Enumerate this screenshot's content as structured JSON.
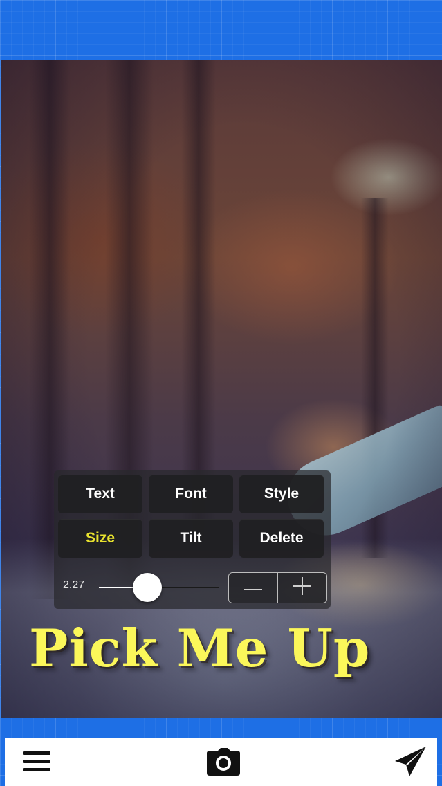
{
  "editor": {
    "caption_text": "Pick Me Up",
    "caption_color": "#fbf75a",
    "background_color": "#1e6fe5"
  },
  "panel": {
    "buttons": [
      {
        "label": "Text",
        "active": false
      },
      {
        "label": "Font",
        "active": false
      },
      {
        "label": "Style",
        "active": false
      },
      {
        "label": "Size",
        "active": true
      },
      {
        "label": "Tilt",
        "active": false
      },
      {
        "label": "Delete",
        "active": false
      }
    ],
    "active_color": "#e8e22e",
    "size_value": "2.27",
    "slider_fraction": 0.41,
    "stepper": {
      "decrement_icon": "minus-icon",
      "increment_icon": "plus-icon"
    }
  },
  "toolbar": {
    "left_icon": "menu-icon",
    "center_icon": "camera-icon",
    "right_icon": "send-icon"
  }
}
